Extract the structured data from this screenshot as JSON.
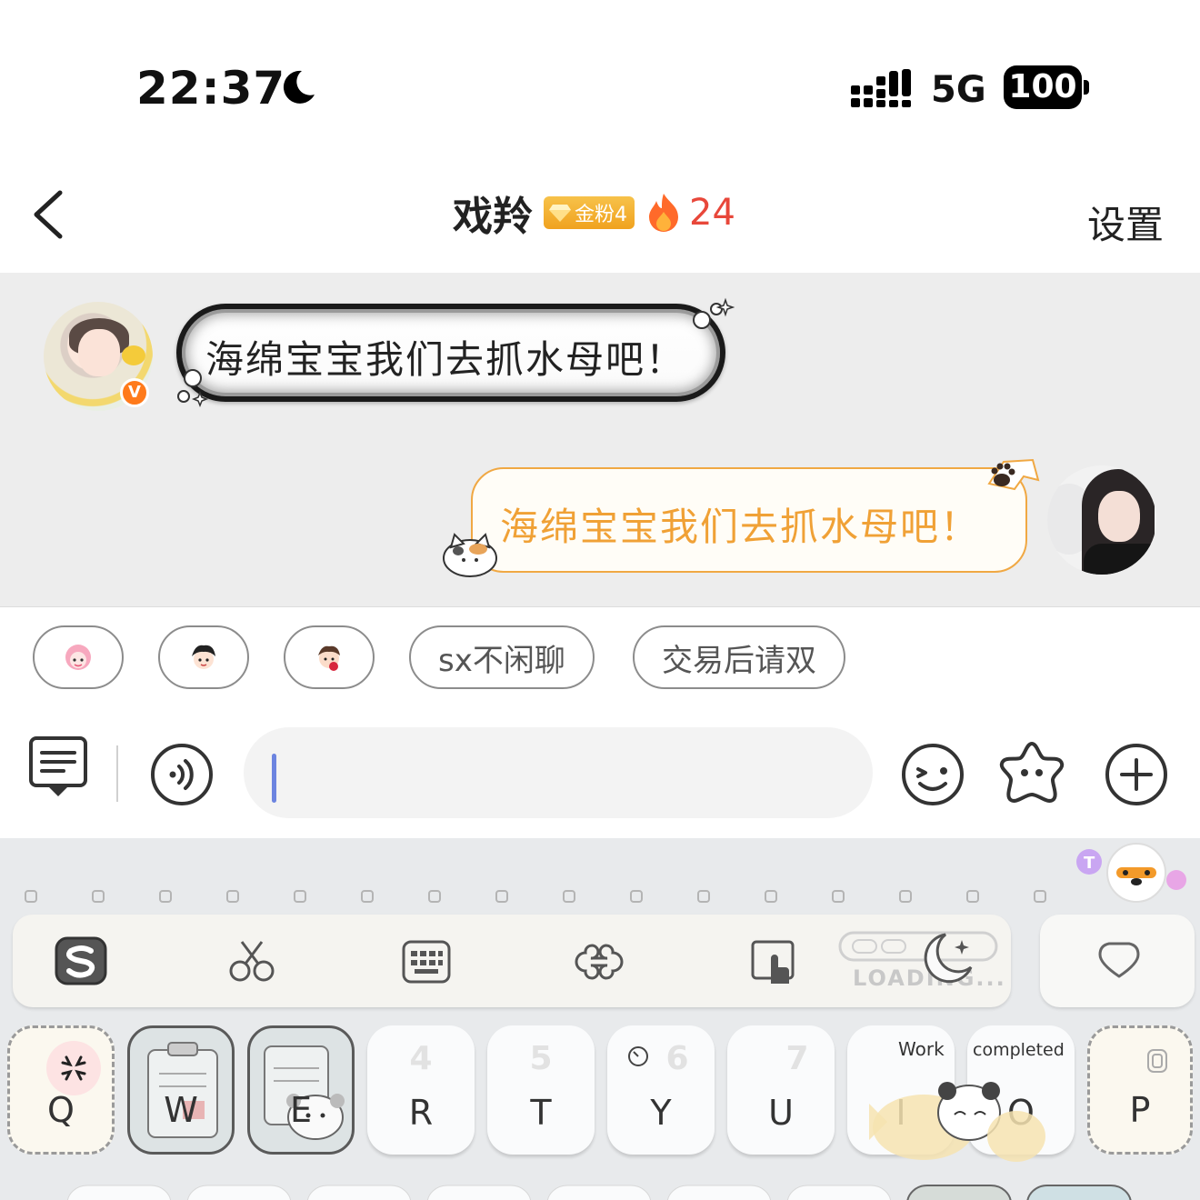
{
  "status_bar": {
    "time": "22:37",
    "network": "5G",
    "battery": "100",
    "icons": [
      "moon-icon",
      "signal-icon"
    ]
  },
  "header": {
    "back_icon": "chevron-left-icon",
    "title": "戏羚",
    "fan_badge": "金粉4",
    "streak_count": "24",
    "settings": "设置"
  },
  "messages": [
    {
      "side": "left",
      "text": "海绵宝宝我们去抓水母吧！",
      "avatar_badge": "v"
    },
    {
      "side": "right",
      "text": "海绵宝宝我们去抓水母吧！"
    }
  ],
  "quick_replies": {
    "emoji_chips": [
      "pink-hair-emoji",
      "boy-emoji",
      "rose-boy-emoji"
    ],
    "text_chips": [
      "sx不闲聊",
      "交易后请双"
    ]
  },
  "input": {
    "value": "",
    "icons": [
      "quick-reply-icon",
      "voice-icon",
      "emoji-icon",
      "sticker-icon",
      "plus-icon"
    ]
  },
  "keyboard": {
    "toolbar_icons": [
      "sogou-logo-icon",
      "scissors-icon",
      "keyboard-icon",
      "bone-icon",
      "touch-icon",
      "moon-icon",
      "heart-icon"
    ],
    "loading_text": "LOADING...",
    "keys": [
      {
        "letter": "Q",
        "number": ""
      },
      {
        "letter": "W",
        "number": ""
      },
      {
        "letter": "E",
        "number": ""
      },
      {
        "letter": "R",
        "number": "4"
      },
      {
        "letter": "T",
        "number": "5"
      },
      {
        "letter": "Y",
        "number": "6"
      },
      {
        "letter": "U",
        "number": "7"
      },
      {
        "letter": "I",
        "number": ""
      },
      {
        "letter": "O",
        "number": ""
      },
      {
        "letter": "P",
        "number": ""
      }
    ],
    "captions": {
      "work": "Work",
      "completed": "completed"
    },
    "accent": "#f0a136"
  }
}
